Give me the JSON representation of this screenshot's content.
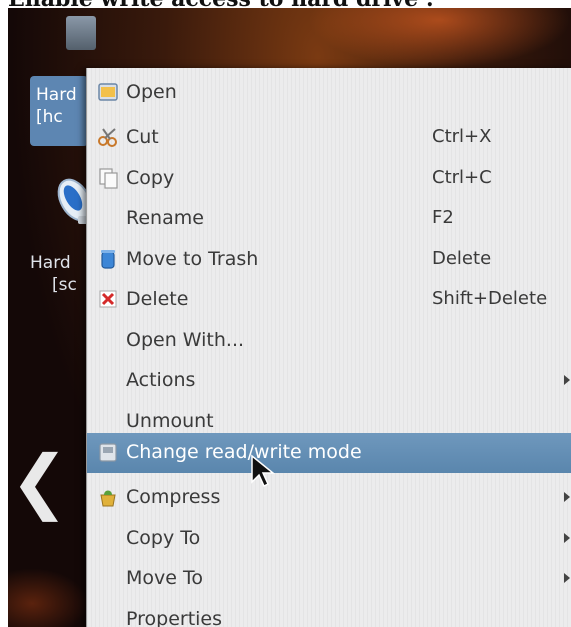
{
  "caption": "Enable write access to hard drive :",
  "desktop": {
    "icon1_label_lines": [
      "Hard",
      "[hc"
    ],
    "icon2_label_lines": [
      "Hard",
      "[sc"
    ]
  },
  "menu": {
    "items": [
      {
        "label": "Open",
        "icon": "open-icon",
        "shortcut": "",
        "submenu": false,
        "highlighted": false
      },
      {
        "label": "Cut",
        "icon": "scissors-icon",
        "shortcut": "Ctrl+X",
        "submenu": false,
        "highlighted": false
      },
      {
        "label": "Copy",
        "icon": "copy-icon",
        "shortcut": "Ctrl+C",
        "submenu": false,
        "highlighted": false
      },
      {
        "label": "Rename",
        "icon": "",
        "shortcut": "F2",
        "submenu": false,
        "highlighted": false
      },
      {
        "label": "Move to Trash",
        "icon": "trash-icon",
        "shortcut": "Delete",
        "submenu": false,
        "highlighted": false
      },
      {
        "label": "Delete",
        "icon": "delete-icon",
        "shortcut": "Shift+Delete",
        "submenu": false,
        "highlighted": false
      },
      {
        "label": "Open With...",
        "icon": "",
        "shortcut": "",
        "submenu": false,
        "highlighted": false
      },
      {
        "label": "Actions",
        "icon": "",
        "shortcut": "",
        "submenu": true,
        "highlighted": false
      },
      {
        "label": "Unmount",
        "icon": "",
        "shortcut": "",
        "submenu": false,
        "highlighted": false
      },
      {
        "label": "Change read/write mode",
        "icon": "drive-icon",
        "shortcut": "",
        "submenu": false,
        "highlighted": true
      },
      {
        "label": "Compress",
        "icon": "compress-icon",
        "shortcut": "",
        "submenu": true,
        "highlighted": false
      },
      {
        "label": "Copy To",
        "icon": "",
        "shortcut": "",
        "submenu": true,
        "highlighted": false
      },
      {
        "label": "Move To",
        "icon": "",
        "shortcut": "",
        "submenu": true,
        "highlighted": false
      },
      {
        "label": "Properties",
        "icon": "",
        "shortcut": "",
        "submenu": false,
        "highlighted": false
      }
    ]
  },
  "colors": {
    "menu_background": "#ececed",
    "highlight": "#5f8bb2",
    "menu_text": "#3a3a3a"
  }
}
